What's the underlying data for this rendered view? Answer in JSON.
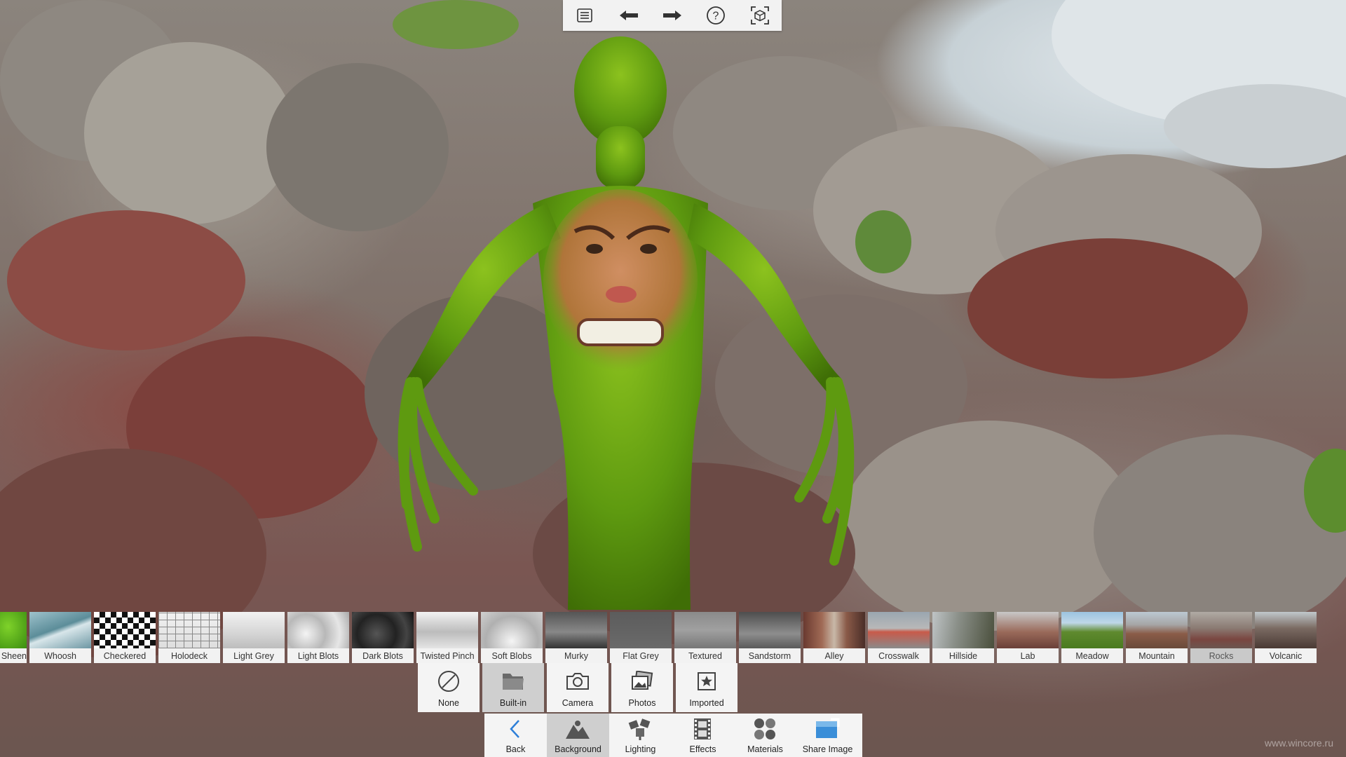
{
  "toolbar": {
    "buttons": [
      {
        "name": "menu-list-icon"
      },
      {
        "name": "undo-arrow-icon"
      },
      {
        "name": "redo-arrow-icon"
      },
      {
        "name": "help-icon"
      },
      {
        "name": "fit-view-icon"
      }
    ]
  },
  "backgrounds": {
    "items": [
      {
        "label": "Sheen",
        "type": "green"
      },
      {
        "label": "Whoosh",
        "type": "whoosh"
      },
      {
        "label": "Checkered",
        "type": "checkered"
      },
      {
        "label": "Holodeck",
        "type": "holodeck"
      },
      {
        "label": "Light Grey",
        "type": "lightgrey"
      },
      {
        "label": "Light Blots",
        "type": "lightblots"
      },
      {
        "label": "Dark Blots",
        "type": "darkblots"
      },
      {
        "label": "Twisted Pinch",
        "type": "twisted"
      },
      {
        "label": "Soft Blobs",
        "type": "softblobs"
      },
      {
        "label": "Murky",
        "type": "murky"
      },
      {
        "label": "Flat Grey",
        "type": "flatgrey"
      },
      {
        "label": "Textured",
        "type": "textured"
      },
      {
        "label": "Sandstorm",
        "type": "sandstorm"
      },
      {
        "label": "Alley",
        "type": "alley"
      },
      {
        "label": "Crosswalk",
        "type": "crosswalk"
      },
      {
        "label": "Hillside",
        "type": "hillside"
      },
      {
        "label": "Lab",
        "type": "lab"
      },
      {
        "label": "Meadow",
        "type": "meadow"
      },
      {
        "label": "Mountain",
        "type": "mountain"
      },
      {
        "label": "Rocks",
        "type": "rocks"
      },
      {
        "label": "Volcanic",
        "type": "volcanic"
      }
    ],
    "selected": "Rocks"
  },
  "sources": {
    "items": [
      {
        "label": "None",
        "icon": "none-icon"
      },
      {
        "label": "Built-in",
        "icon": "folder-icon"
      },
      {
        "label": "Camera",
        "icon": "camera-icon"
      },
      {
        "label": "Photos",
        "icon": "photos-icon"
      },
      {
        "label": "Imported",
        "icon": "imported-star-icon"
      }
    ],
    "selected": "Built-in"
  },
  "commands": {
    "items": [
      {
        "label": "Back",
        "icon": "back-chevron-icon"
      },
      {
        "label": "Background",
        "icon": "background-landscape-icon"
      },
      {
        "label": "Lighting",
        "icon": "lighting-icon"
      },
      {
        "label": "Effects",
        "icon": "effects-film-icon"
      },
      {
        "label": "Materials",
        "icon": "materials-spheres-icon"
      },
      {
        "label": "Share Image",
        "icon": "share-image-icon"
      }
    ],
    "selected": "Background"
  },
  "watermark": "www.wincore.ru",
  "colors": {
    "figure_green": "#5e9a10",
    "toolbar_bg": "#f2f2f2",
    "selected_bg": "#c9c9c9"
  }
}
